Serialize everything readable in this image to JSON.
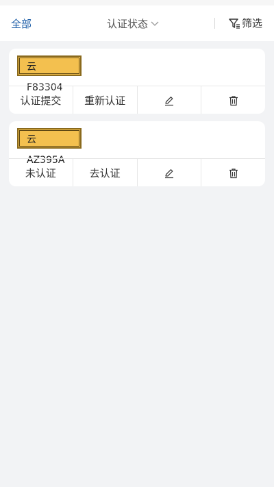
{
  "filter_bar": {
    "all_label": "全部",
    "status_label": "认证状态",
    "screen_label": "筛选"
  },
  "cards": [
    {
      "plate": "云F83304",
      "actions": {
        "primary": "认证提交",
        "secondary": "重新认证",
        "edit_icon": "pencil-icon",
        "delete_icon": "trash-icon"
      }
    },
    {
      "plate": "云AZ395A",
      "actions": {
        "primary": "未认证",
        "secondary": "去认证",
        "edit_icon": "pencil-icon",
        "delete_icon": "trash-icon"
      }
    }
  ],
  "colors": {
    "accent": "#1f5fa8",
    "plate_yellow": "#f3c04f",
    "background": "#f2f3f5"
  }
}
